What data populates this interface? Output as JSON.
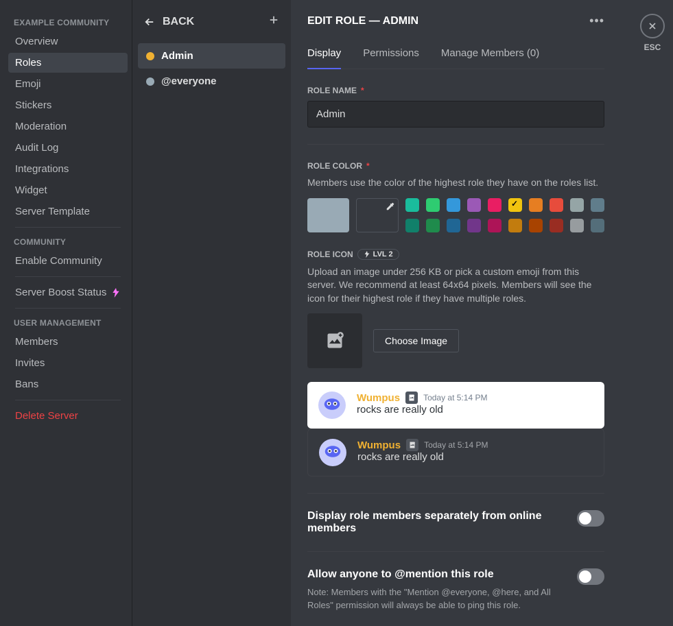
{
  "sidebar": {
    "server_name": "Example Community",
    "groups": [
      {
        "items": [
          "Overview",
          "Roles",
          "Emoji",
          "Stickers",
          "Moderation",
          "Audit Log",
          "Integrations",
          "Widget",
          "Server Template"
        ],
        "selected": 1
      },
      {
        "heading": "Community",
        "items": [
          "Enable Community"
        ]
      },
      {
        "items": [
          "Server Boost Status"
        ],
        "boost": true
      },
      {
        "heading": "User Management",
        "items": [
          "Members",
          "Invites",
          "Bans"
        ]
      },
      {
        "items": [
          "Delete Server"
        ],
        "danger": true
      }
    ]
  },
  "role_list": {
    "back": "Back",
    "roles": [
      {
        "name": "Admin",
        "color": "#f0b132",
        "selected": true
      },
      {
        "name": "@everyone",
        "color": "#99aab5"
      }
    ]
  },
  "main": {
    "title": "Edit Role — Admin",
    "tabs": [
      "Display",
      "Permissions",
      "Manage Members (0)"
    ],
    "active_tab": 0,
    "role_name": {
      "label": "Role Name",
      "value": "Admin"
    },
    "role_color": {
      "label": "Role Color",
      "helper": "Members use the color of the highest role they have on the roles list.",
      "default": "#99aab5",
      "colors_row1": [
        "#1abc9c",
        "#2ecc71",
        "#3498db",
        "#9b59b6",
        "#e91e63",
        "#f1c40f",
        "#e67e22",
        "#e74c3c",
        "#95a5a6",
        "#607d8b"
      ],
      "colors_row2": [
        "#11806a",
        "#1f8b4c",
        "#206694",
        "#71368a",
        "#ad1457",
        "#c27c0e",
        "#a84300",
        "#992d22",
        "#979c9f",
        "#546e7a"
      ],
      "selected": "#f1c40f"
    },
    "role_icon": {
      "label": "Role Icon",
      "badge": "LVL 2",
      "helper": "Upload an image under 256 KB or pick a custom emoji from this server. We recommend at least 64x64 pixels. Members will see the icon for their highest role if they have multiple roles.",
      "choose_btn": "Choose Image",
      "preview_user": "Wumpus",
      "preview_time": "Today at 5:14 PM",
      "preview_msg": "rocks are really old"
    },
    "toggle1": {
      "label": "Display role members separately from online members"
    },
    "toggle2": {
      "label_pre": "Allow anyone to ",
      "label_bold": "@mention",
      "label_post": " this role",
      "note": "Note: Members with the \"Mention @everyone, @here, and All Roles\" permission will always be able to ping this role."
    }
  },
  "close": {
    "esc": "ESC"
  }
}
